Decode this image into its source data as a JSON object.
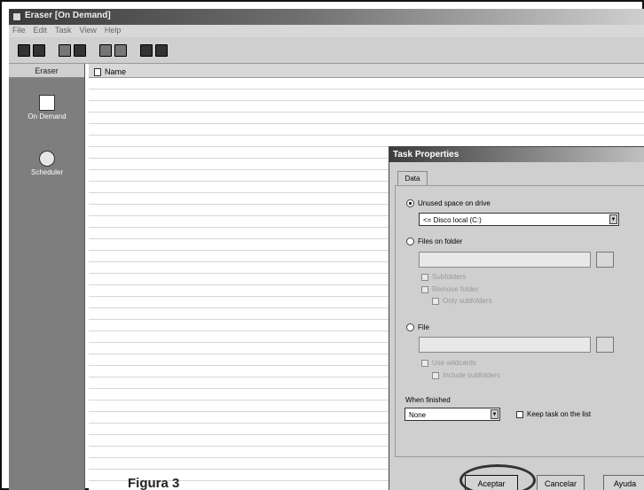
{
  "window": {
    "title": "Eraser [On Demand]",
    "menu": [
      "File",
      "Edit",
      "Task",
      "View",
      "Help"
    ]
  },
  "sidebar": {
    "header": "Eraser",
    "items": [
      {
        "label": "On Demand",
        "icon": "on-demand-icon"
      },
      {
        "label": "Scheduler",
        "icon": "scheduler-icon"
      }
    ]
  },
  "list": {
    "column_name": "Name"
  },
  "caption": "Figura 3",
  "dialog": {
    "title": "Task Properties",
    "tab": "Data",
    "option_unused": "Unused space on drive",
    "drive_value": "<= Disco local (C:)",
    "option_files": "Files on folder",
    "subfolders": "Subfolders",
    "remove_folder": "Remove folder",
    "only_subfolders": "Only subfolders",
    "option_file": "File",
    "use_wildcards": "Use wildcards",
    "include_subfolders": "Include subfolders",
    "when_finished_label": "When finished",
    "when_finished_value": "None",
    "keep_task": "Keep task on the list",
    "buttons": {
      "ok": "Aceptar",
      "cancel": "Cancelar",
      "help": "Ayuda"
    }
  }
}
